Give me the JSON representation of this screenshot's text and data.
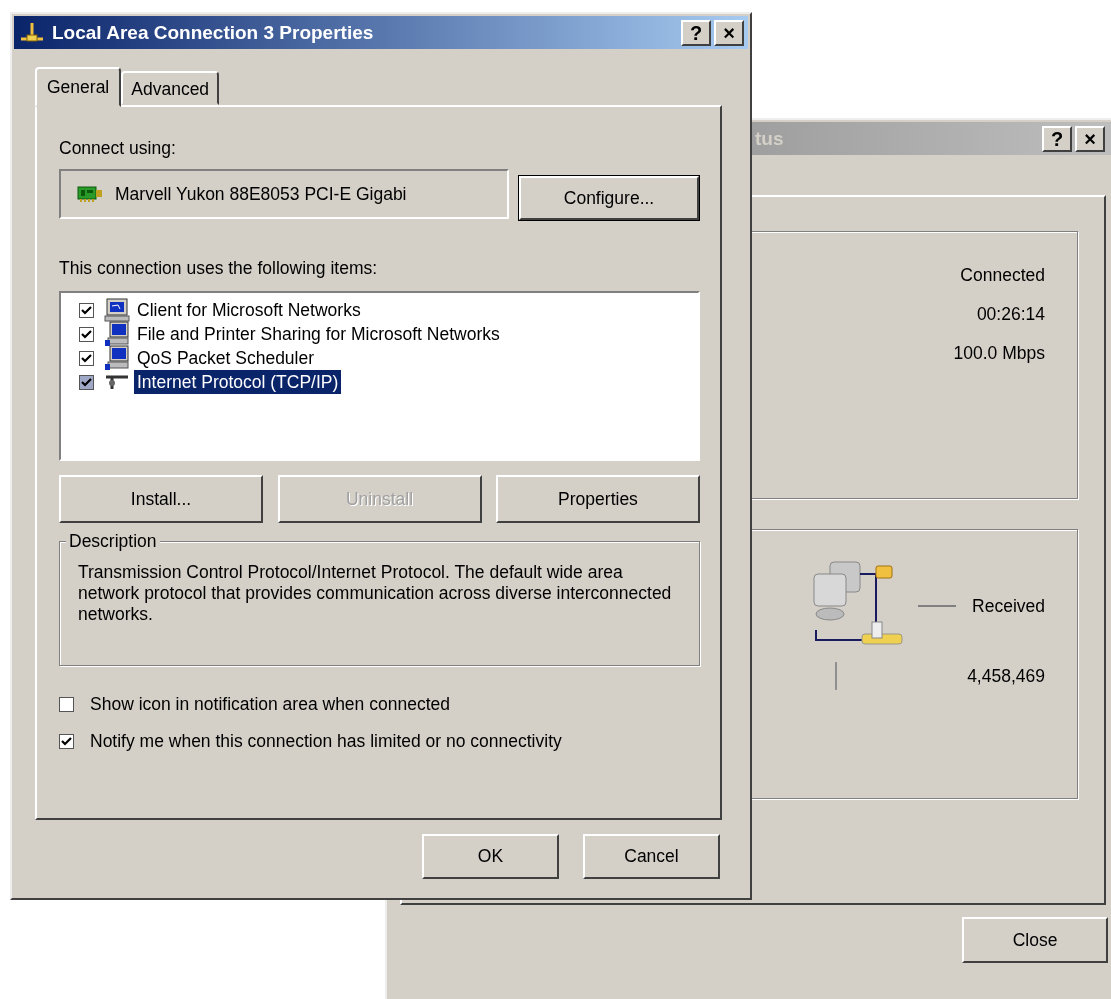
{
  "status_window": {
    "title": "tus",
    "title_buttons": [
      "?",
      "×"
    ],
    "connection_values": [
      "Connected",
      "00:26:14",
      "100.0 Mbps"
    ],
    "activity": {
      "label": "Received",
      "value": "4,458,469"
    },
    "close_button": "Close"
  },
  "properties_window": {
    "title": "Local Area Connection 3 Properties",
    "title_buttons": [
      "?",
      "×"
    ],
    "tabs": [
      {
        "label": "General",
        "selected": true
      },
      {
        "label": "Advanced",
        "selected": false
      }
    ],
    "connect_using_label": "Connect using:",
    "adapter": "Marvell Yukon 88E8053 PCI-E Gigabi",
    "configure_button": "Configure...",
    "items_label": "This connection uses the following items:",
    "items": [
      {
        "label": "Client for Microsoft Networks",
        "kind": "client",
        "checked": true,
        "selected": false
      },
      {
        "label": "File and Printer Sharing for Microsoft Networks",
        "kind": "service",
        "checked": true,
        "selected": false
      },
      {
        "label": "QoS Packet Scheduler",
        "kind": "service",
        "checked": true,
        "selected": false
      },
      {
        "label": "Internet Protocol (TCP/IP)",
        "kind": "protocol",
        "checked": true,
        "selected": true
      }
    ],
    "item_buttons": [
      {
        "label": "Install...",
        "disabled": false
      },
      {
        "label": "Uninstall",
        "disabled": true
      },
      {
        "label": "Properties",
        "disabled": false
      }
    ],
    "description": {
      "title": "Description",
      "text": "Transmission Control Protocol/Internet Protocol. The default wide area network protocol that provides communication across diverse interconnected networks."
    },
    "options": [
      {
        "label": "Show icon in notification area when connected",
        "checked": false
      },
      {
        "label": "Notify me when this connection has limited or no connectivity",
        "checked": true
      }
    ],
    "dialog_buttons": [
      "OK",
      "Cancel"
    ]
  }
}
